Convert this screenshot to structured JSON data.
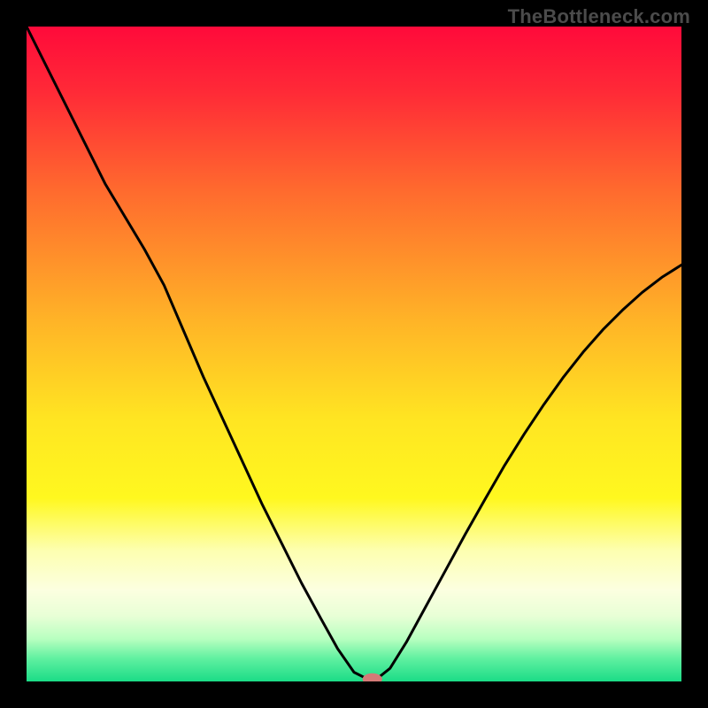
{
  "watermark": "TheBottleneck.com",
  "chart_data": {
    "type": "line",
    "title": "",
    "xlabel": "",
    "ylabel": "",
    "xlim": [
      0,
      100
    ],
    "ylim": [
      0,
      100
    ],
    "grid": false,
    "legend": false,
    "background_gradient": [
      {
        "stop": 0.0,
        "color": "#ff0a3a"
      },
      {
        "stop": 0.1,
        "color": "#ff2a37"
      },
      {
        "stop": 0.25,
        "color": "#ff6a2e"
      },
      {
        "stop": 0.45,
        "color": "#ffb427"
      },
      {
        "stop": 0.6,
        "color": "#ffe522"
      },
      {
        "stop": 0.72,
        "color": "#fff81f"
      },
      {
        "stop": 0.8,
        "color": "#fdffb0"
      },
      {
        "stop": 0.86,
        "color": "#fcffe0"
      },
      {
        "stop": 0.9,
        "color": "#e8ffd6"
      },
      {
        "stop": 0.935,
        "color": "#b8ffc0"
      },
      {
        "stop": 0.965,
        "color": "#60f0a0"
      },
      {
        "stop": 1.0,
        "color": "#1bdc87"
      }
    ],
    "series": [
      {
        "name": "bottleneck-curve",
        "stroke": "#000000",
        "width": 3,
        "x": [
          0.0,
          3.0,
          6.0,
          9.0,
          12.0,
          15.0,
          18.0,
          21.0,
          24.0,
          27.0,
          30.0,
          33.0,
          36.0,
          39.0,
          42.0,
          45.0,
          47.5,
          50.0,
          52.0,
          53.5,
          55.5,
          58.0,
          61.0,
          64.0,
          67.0,
          70.0,
          73.0,
          76.0,
          79.0,
          82.0,
          85.0,
          88.0,
          91.0,
          94.0,
          97.0,
          100.0
        ],
        "y": [
          100.0,
          94.0,
          88.0,
          82.0,
          76.0,
          71.0,
          66.0,
          60.5,
          53.5,
          46.5,
          40.0,
          33.5,
          27.0,
          21.0,
          15.0,
          9.5,
          5.0,
          1.4,
          0.4,
          0.4,
          2.0,
          6.0,
          11.5,
          17.0,
          22.5,
          27.8,
          33.0,
          37.8,
          42.3,
          46.5,
          50.3,
          53.7,
          56.7,
          59.4,
          61.7,
          63.6
        ]
      }
    ],
    "marker": {
      "name": "optimum-marker",
      "x": 52.8,
      "y": 0.35,
      "rx": 1.5,
      "ry": 0.9,
      "fill": "#d47a77"
    }
  }
}
